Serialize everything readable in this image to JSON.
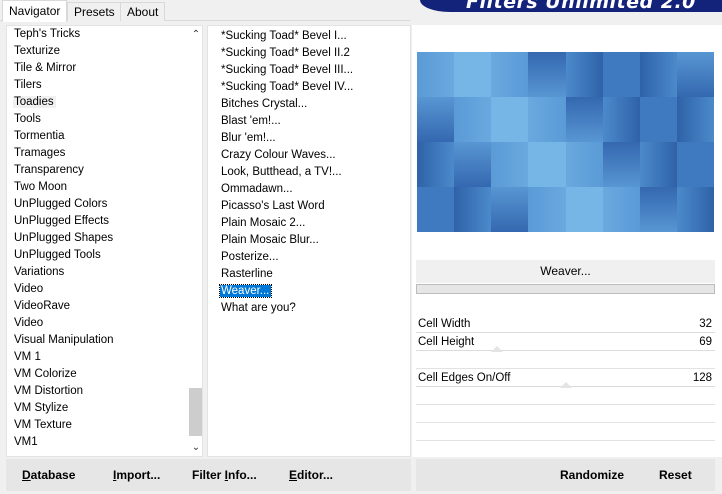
{
  "tabs": [
    {
      "label": "Navigator",
      "active": true
    },
    {
      "label": "Presets",
      "active": false
    },
    {
      "label": "About",
      "active": false
    }
  ],
  "banner": {
    "title": "Filters Unlimited 2.0"
  },
  "categories": {
    "selected": "Toadies",
    "items": [
      "Teph's Tricks",
      "Texturize",
      "Tile & Mirror",
      "Tilers",
      "Toadies",
      "Tools",
      "Tormentia",
      "Tramages",
      "Transparency",
      "Two Moon",
      "UnPlugged Colors",
      "UnPlugged Effects",
      "UnPlugged Shapes",
      "UnPlugged Tools",
      "Variations",
      "Video",
      "VideoRave",
      "Video",
      "Visual Manipulation",
      "VM 1",
      "VM Colorize",
      "VM Distortion",
      "VM Stylize",
      "VM Texture",
      "VM1"
    ]
  },
  "filters": {
    "selected": "Weaver...",
    "items": [
      "*Sucking Toad*  Bevel I...",
      "*Sucking Toad*  Bevel II.2",
      "*Sucking Toad*  Bevel III...",
      "*Sucking Toad*  Bevel IV...",
      "Bitches Crystal...",
      "Blast 'em!...",
      "Blur 'em!...",
      "Crazy Colour Waves...",
      "Look, Butthead, a TV!...",
      "Ommadawn...",
      "Picasso's Last Word",
      "Plain Mosaic 2...",
      "Plain Mosaic Blur...",
      "Posterize...",
      "Rasterline",
      "Weaver...",
      "What are you?"
    ]
  },
  "current_filter": {
    "title": "Weaver..."
  },
  "params": [
    {
      "label": "Cell Width",
      "value": "32"
    },
    {
      "label": "Cell Height",
      "value": "69"
    },
    {
      "label": "Cell Edges On/Off",
      "value": "128"
    }
  ],
  "buttons": {
    "database": {
      "pre": "",
      "ul": "D",
      "post": "atabase"
    },
    "import": {
      "pre": "",
      "ul": "I",
      "post": "mport..."
    },
    "filter_info": {
      "pre": "Filter ",
      "ul": "I",
      "post": "nfo..."
    },
    "editor": {
      "pre": "",
      "ul": "E",
      "post": "ditor..."
    },
    "randomize": "Randomize",
    "reset": "Reset"
  },
  "colors": {
    "selection": "#0078d7",
    "banner": "#14237a"
  }
}
